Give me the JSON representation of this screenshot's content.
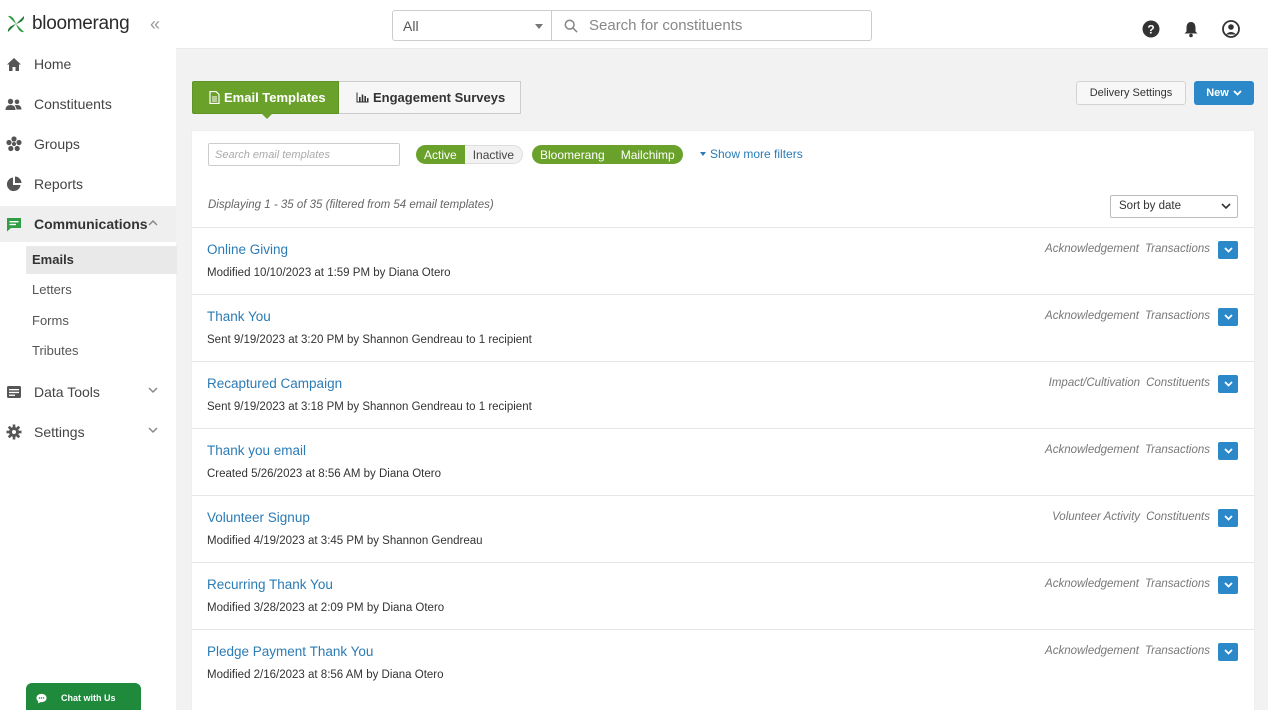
{
  "brand": {
    "name": "bloomerang"
  },
  "search": {
    "scope": "All",
    "placeholder": "Search for constituents"
  },
  "sidebar": {
    "items": [
      {
        "label": "Home",
        "icon": "home-icon"
      },
      {
        "label": "Constituents",
        "icon": "people-icon"
      },
      {
        "label": "Groups",
        "icon": "groups-icon"
      },
      {
        "label": "Reports",
        "icon": "pie-chart-icon"
      },
      {
        "label": "Communications",
        "icon": "message-icon"
      },
      {
        "label": "Data Tools",
        "icon": "data-tools-icon"
      },
      {
        "label": "Settings",
        "icon": "gear-icon"
      }
    ],
    "sub_items": [
      {
        "label": "Emails"
      },
      {
        "label": "Letters"
      },
      {
        "label": "Forms"
      },
      {
        "label": "Tributes"
      }
    ]
  },
  "chat": {
    "label": "Chat with Us"
  },
  "tabs": {
    "email": "Email Templates",
    "surveys": "Engagement Surveys"
  },
  "actions": {
    "delivery": "Delivery Settings",
    "new": "New"
  },
  "filters": {
    "search_placeholder": "Search email templates",
    "status": [
      "Active",
      "Inactive"
    ],
    "providers": [
      "Bloomerang",
      "Mailchimp"
    ],
    "more": "Show more filters"
  },
  "listing": {
    "displaying": "Displaying 1 - 35 of 35 (filtered from 54 email templates)",
    "sort": "Sort by date"
  },
  "templates": [
    {
      "title": "Online Giving",
      "meta": "Modified 10/10/2023 at 1:59 PM by Diana Otero",
      "tag1": "Acknowledgement",
      "tag2": "Transactions"
    },
    {
      "title": "Thank You",
      "meta": "Sent 9/19/2023 at 3:20 PM by Shannon Gendreau to 1 recipient",
      "tag1": "Acknowledgement",
      "tag2": "Transactions"
    },
    {
      "title": "Recaptured Campaign",
      "meta": "Sent 9/19/2023 at 3:18 PM by Shannon Gendreau to 1 recipient",
      "tag1": "Impact/Cultivation",
      "tag2": "Constituents"
    },
    {
      "title": "Thank you email",
      "meta": "Created 5/26/2023 at 8:56 AM by Diana Otero",
      "tag1": "Acknowledgement",
      "tag2": "Transactions"
    },
    {
      "title": "Volunteer Signup",
      "meta": "Modified 4/19/2023 at 3:45 PM by Shannon Gendreau",
      "tag1": "Volunteer Activity",
      "tag2": "Constituents"
    },
    {
      "title": "Recurring Thank You",
      "meta": "Modified 3/28/2023 at 2:09 PM by Diana Otero",
      "tag1": "Acknowledgement",
      "tag2": "Transactions"
    },
    {
      "title": "Pledge Payment Thank You",
      "meta": "Modified 2/16/2023 at 8:56 AM by Diana Otero",
      "tag1": "Acknowledgement",
      "tag2": "Transactions"
    }
  ],
  "colors": {
    "brand_green": "#6aa12b",
    "link_blue": "#2b7bb5",
    "button_blue": "#2b88c9",
    "chat_green": "#1f8a3c"
  }
}
